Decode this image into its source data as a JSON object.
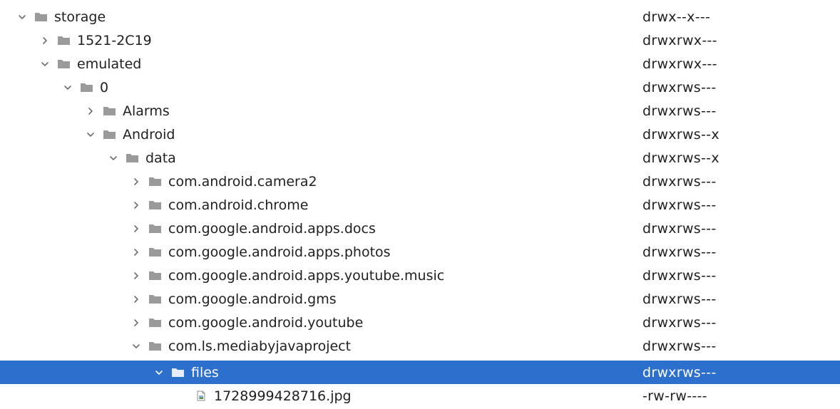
{
  "file_tree": {
    "partial_top_label": "",
    "rows": [
      {
        "name": "storage",
        "permissions": "drwx--x---",
        "type": "folder",
        "expanded": true,
        "depth": 0
      },
      {
        "name": "1521-2C19",
        "permissions": "drwxrwx---",
        "type": "folder",
        "expanded": false,
        "depth": 1
      },
      {
        "name": "emulated",
        "permissions": "drwxrwx---",
        "type": "folder",
        "expanded": true,
        "depth": 1
      },
      {
        "name": "0",
        "permissions": "drwxrws---",
        "type": "folder",
        "expanded": true,
        "depth": 2
      },
      {
        "name": "Alarms",
        "permissions": "drwxrws---",
        "type": "folder",
        "expanded": false,
        "depth": 3
      },
      {
        "name": "Android",
        "permissions": "drwxrws--x",
        "type": "folder",
        "expanded": true,
        "depth": 3
      },
      {
        "name": "data",
        "permissions": "drwxrws--x",
        "type": "folder",
        "expanded": true,
        "depth": 4
      },
      {
        "name": "com.android.camera2",
        "permissions": "drwxrws---",
        "type": "folder",
        "expanded": false,
        "depth": 5
      },
      {
        "name": "com.android.chrome",
        "permissions": "drwxrws---",
        "type": "folder",
        "expanded": false,
        "depth": 5
      },
      {
        "name": "com.google.android.apps.docs",
        "permissions": "drwxrws---",
        "type": "folder",
        "expanded": false,
        "depth": 5
      },
      {
        "name": "com.google.android.apps.photos",
        "permissions": "drwxrws---",
        "type": "folder",
        "expanded": false,
        "depth": 5
      },
      {
        "name": "com.google.android.apps.youtube.music",
        "permissions": "drwxrws---",
        "type": "folder",
        "expanded": false,
        "depth": 5
      },
      {
        "name": "com.google.android.gms",
        "permissions": "drwxrws---",
        "type": "folder",
        "expanded": false,
        "depth": 5
      },
      {
        "name": "com.google.android.youtube",
        "permissions": "drwxrws---",
        "type": "folder",
        "expanded": false,
        "depth": 5
      },
      {
        "name": "com.ls.mediabyjavaproject",
        "permissions": "drwxrws---",
        "type": "folder",
        "expanded": true,
        "depth": 5
      },
      {
        "name": "files",
        "permissions": "drwxrws---",
        "type": "folder",
        "expanded": true,
        "depth": 6,
        "selected": true
      },
      {
        "name": "1728999428716.jpg",
        "permissions": "-rw-rw----",
        "type": "file",
        "depth": 7
      }
    ]
  },
  "colors": {
    "selection": "#2c6fcd",
    "folder_icon": "#9a9a9a",
    "text": "#1f1f1f",
    "chevron": "#6e6e6e"
  },
  "icons": {
    "expanded": "chevron-down-icon",
    "collapsed": "chevron-right-icon",
    "folder": "folder-icon",
    "image_file": "image-file-icon"
  }
}
